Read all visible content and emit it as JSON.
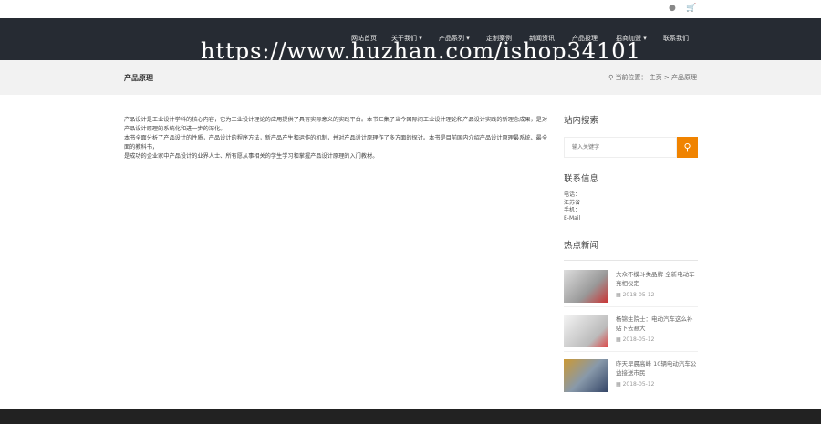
{
  "topbar": {
    "icons": [
      "user-icon",
      "cart-icon"
    ]
  },
  "nav": {
    "items": [
      "网站首页",
      "关于我们 ▾",
      "产品系列 ▾",
      "定制案例",
      "新闻资讯",
      "产品投理",
      "招商加盟 ▾",
      "联系我们"
    ]
  },
  "watermark": "https://www.huzhan.com/ishop34101",
  "page": {
    "title": "产品原理",
    "breadcrumb_label": "当前位置：",
    "breadcrumb_home": "主页",
    "breadcrumb_current": "产品原理"
  },
  "content": {
    "paragraphs": [
      "产品设计是工业设计学科的核心内容，它为工业设计理论的应用提供了具有实际意义的实践平台。本书汇集了当今国际间工业设计理论和产品设计实践的新理念成果，是对产品设计原理的系统化和进一步的深化。",
      "本书全面分析了产品设计的性质，产品设计的程序方法，新产品产生和运作的机制，并对产品设计原理作了多方面的探讨。本书是目前国内介绍产品设计原理最系统、最全面的教科书，",
      "是成功的企业家中产品设计的业界人士、所有愿从事相关的学生学习和掌握产品设计原理的入门教材。"
    ]
  },
  "sidebar": {
    "search_title": "站内搜索",
    "search_placeholder": "输入关键字",
    "contact_title": "联系信息",
    "contact": [
      "电话：",
      "江苏省",
      "手机：",
      "E-Mail"
    ],
    "news_title": "热点新闻",
    "news": [
      {
        "title": "大众不模斗类品牌 全新电动车亮相仪定",
        "date": "2018-05-12"
      },
      {
        "title": "杨锦生院士：电动汽车这么补贴下去悬大",
        "date": "2018-05-12"
      },
      {
        "title": "昨天早晨高峰 10辆电动汽车公益接送市民",
        "date": "2018-05-12"
      }
    ]
  }
}
